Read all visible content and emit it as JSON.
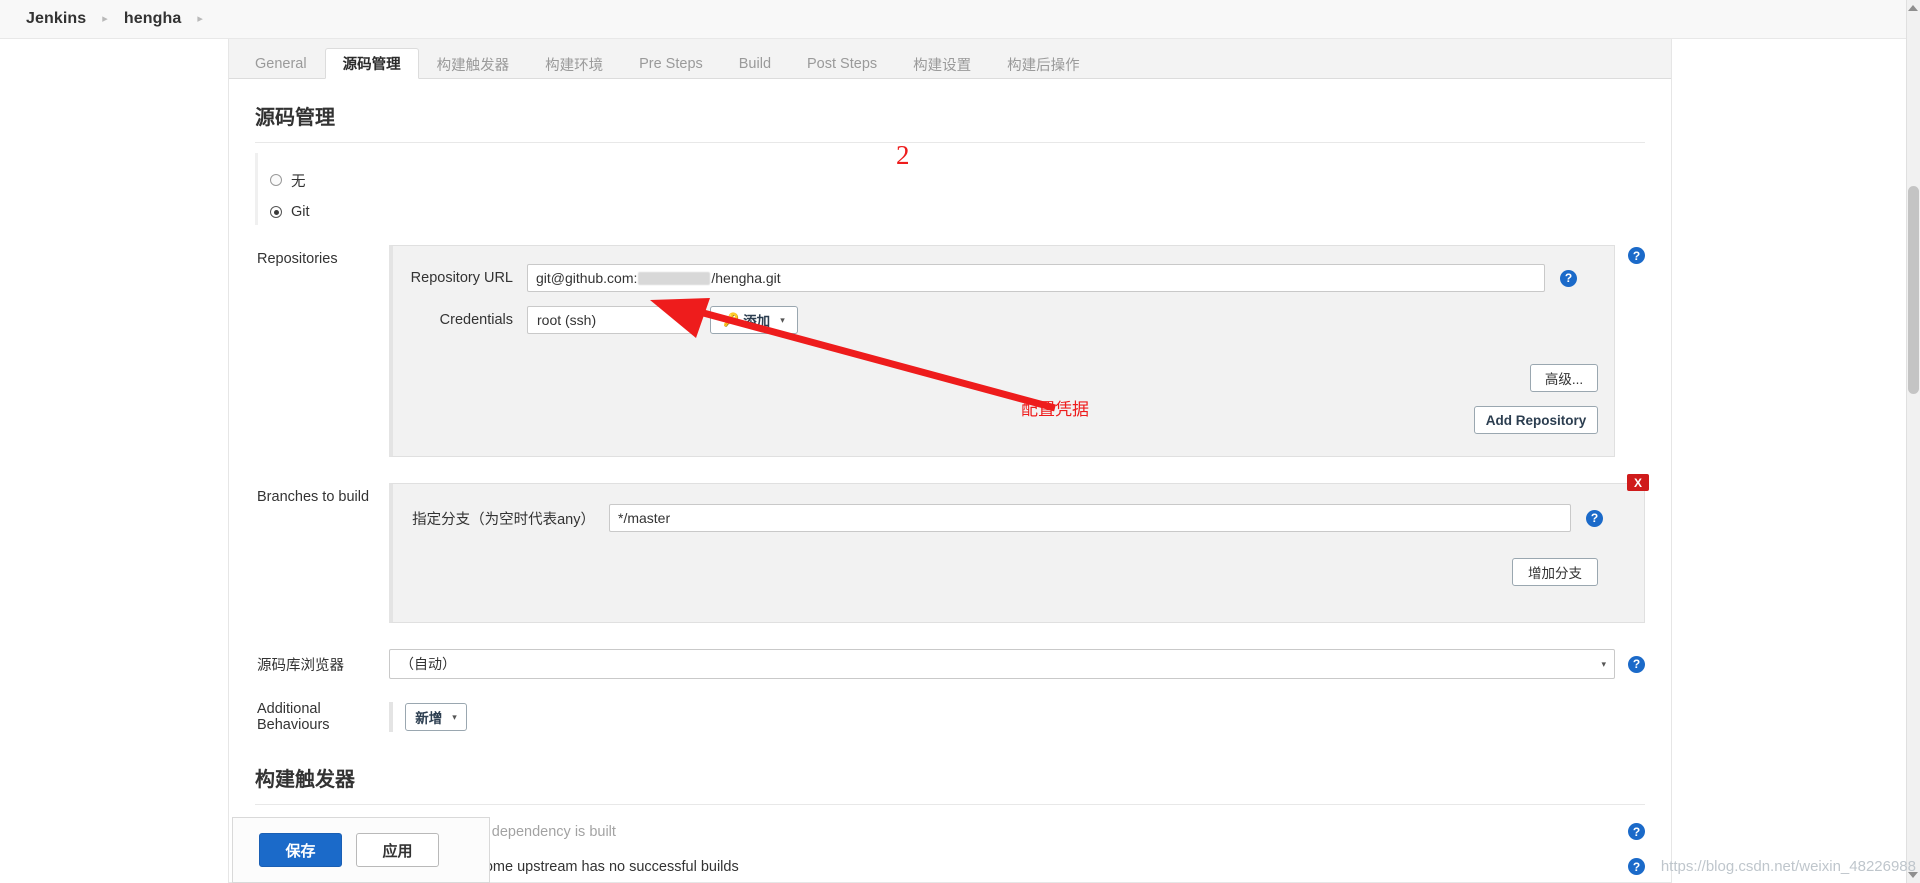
{
  "breadcrumb": {
    "items": [
      {
        "label": "Jenkins"
      },
      {
        "label": "hengha"
      }
    ],
    "separator": "▸"
  },
  "tabs": [
    {
      "id": "general",
      "label": "General",
      "active": false
    },
    {
      "id": "scm",
      "label": "源码管理",
      "active": true
    },
    {
      "id": "triggers",
      "label": "构建触发器",
      "active": false
    },
    {
      "id": "environment",
      "label": "构建环境",
      "active": false
    },
    {
      "id": "pre-steps",
      "label": "Pre Steps",
      "active": false
    },
    {
      "id": "build",
      "label": "Build",
      "active": false
    },
    {
      "id": "post-steps",
      "label": "Post Steps",
      "active": false
    },
    {
      "id": "build-settings",
      "label": "构建设置",
      "active": false
    },
    {
      "id": "post-build",
      "label": "构建后操作",
      "active": false
    }
  ],
  "scm": {
    "heading": "源码管理",
    "options": [
      {
        "id": "none",
        "label": "无",
        "selected": false
      },
      {
        "id": "git",
        "label": "Git",
        "selected": true
      }
    ],
    "repositories": {
      "label": "Repositories",
      "repository_url": {
        "label": "Repository URL",
        "value_prefix": "git@github.com:",
        "value_suffix": "/hengha.git",
        "masked": true
      },
      "credentials": {
        "label": "Credentials",
        "value": "root (ssh)",
        "add_button": "添加",
        "add_icon": "key-icon",
        "caret": "▾"
      },
      "advanced_button": "高级...",
      "add_repository_button": "Add Repository"
    },
    "branches": {
      "label": "Branches to build",
      "specifier_label": "指定分支（为空时代表any）",
      "specifier_value": "*/master",
      "add_branch_button": "增加分支",
      "delete_badge": "X"
    },
    "repo_browser": {
      "label": "源码库浏览器",
      "value": "（自动）",
      "caret": "▾"
    },
    "additional_behaviours": {
      "label": "Additional Behaviours",
      "add_button": "新增",
      "caret": "▾"
    }
  },
  "triggers": {
    "heading": "构建触发器",
    "checkboxes": [
      {
        "id": "snapshot-dependency",
        "label": "Build whenever a SNAPSHOT dependency is built",
        "checked": true
      },
      {
        "id": "quiet-upstream",
        "label": "Quietly schedule build when some upstream has no successful builds",
        "checked": true
      }
    ]
  },
  "actionbar": {
    "save_label": "保存",
    "apply_label": "应用"
  },
  "annotations": {
    "step_number": "2",
    "credentials_note": "配置凭据"
  },
  "watermark": "https://blog.csdn.net/weixin_48226988",
  "help_icon_glyph": "?",
  "colors": {
    "accent": "#1b6ac9",
    "annotation": "#ee1c1c",
    "danger": "#cf1b1b",
    "panel_bg": "#f2f2f2"
  }
}
